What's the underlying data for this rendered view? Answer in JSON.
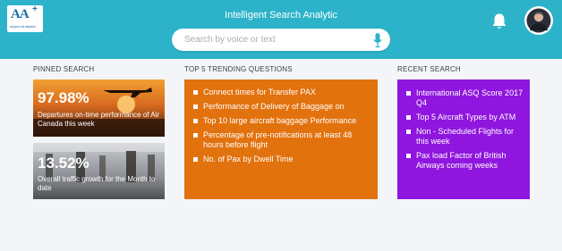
{
  "header": {
    "title": "Intelligent Search Analytic",
    "logo_text": "AA",
    "logo_sub": "Airport Analytics"
  },
  "search": {
    "placeholder": "Search by voice or text"
  },
  "pinned": {
    "heading": "PINNED SEARCH",
    "tiles": [
      {
        "value": "97.98%",
        "text": "Departures on-time performance of Air Canada this week"
      },
      {
        "value": "13.52%",
        "text": "Overall traffic growth for the Month to date"
      }
    ]
  },
  "trending": {
    "heading": "TOP 5 TRENDING QUESTIONS",
    "color": "#e2720e",
    "items": [
      "Connect times for Transfer PAX",
      "Performance of Delivery of Baggage on",
      "Top 10 large aircraft baggage Performance",
      "Percentage of pre-notifications at least 48 hours before flight",
      "No. of Pax by Dwell Time"
    ]
  },
  "recent": {
    "heading": "RECENT SEARCH",
    "color": "#8f16de",
    "items": [
      "International ASQ Score 2017 Q4",
      "Top 5 Aircraft Types by ATM",
      "Non - Scheduled Flights for this week",
      "Pax load Factor of British Airways coming weeks"
    ]
  },
  "icons": {
    "mic": "microphone-icon",
    "bell": "bell-icon",
    "avatar": "user-avatar-icon"
  },
  "colors": {
    "header": "#2db3c9",
    "background": "#f4f5f8"
  }
}
